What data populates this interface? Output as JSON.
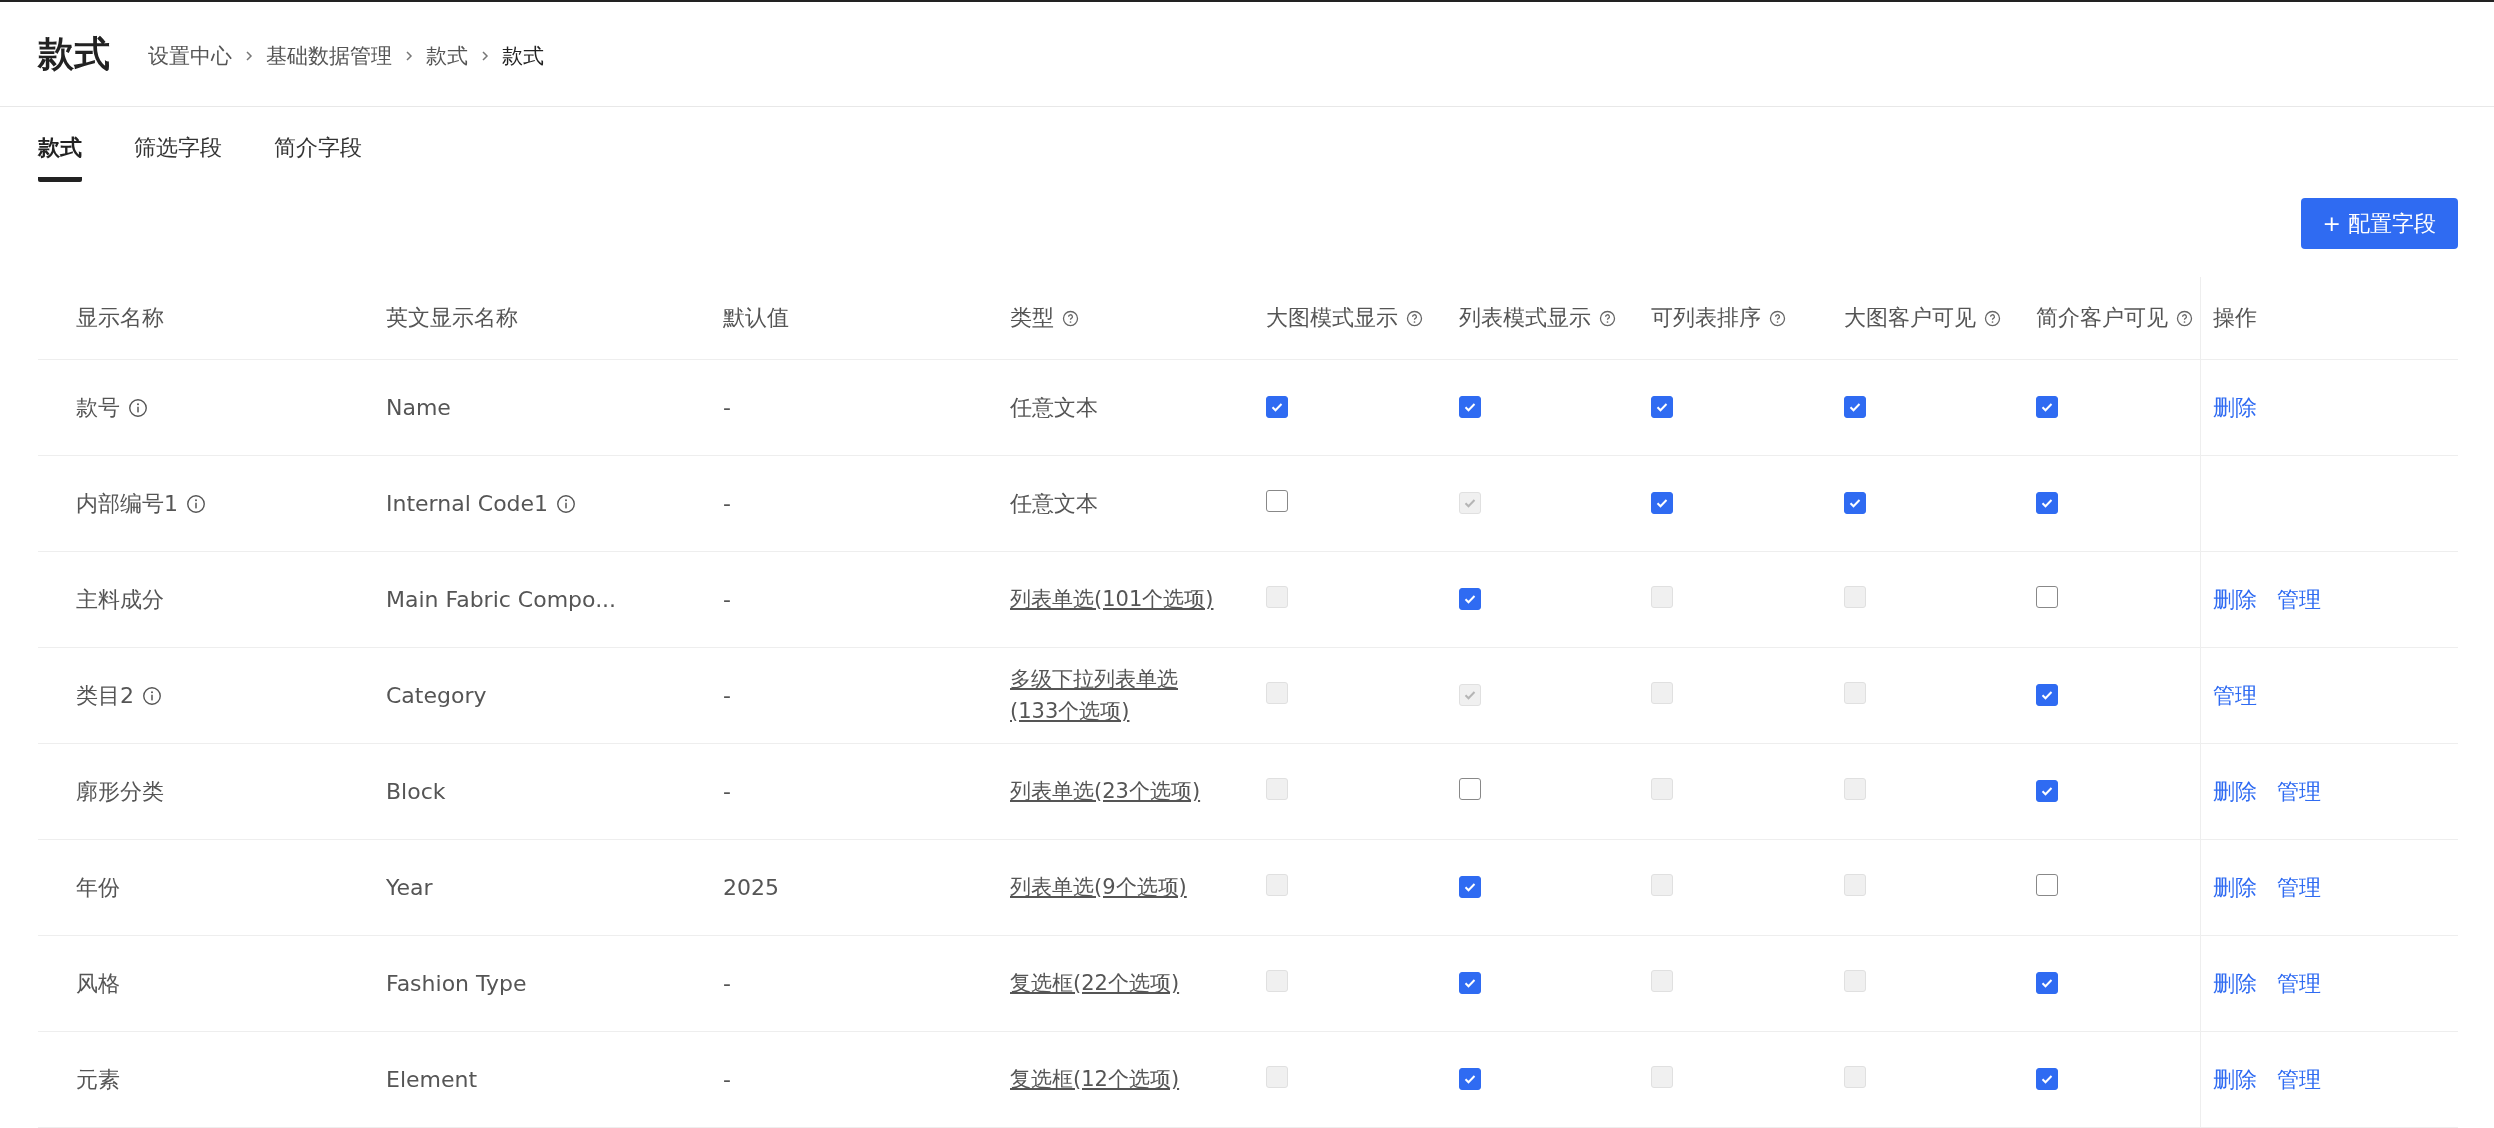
{
  "page": {
    "title": "款式",
    "breadcrumb": [
      "设置中心",
      "基础数据管理",
      "款式",
      "款式"
    ]
  },
  "tabs": [
    {
      "label": "款式",
      "selected": true
    },
    {
      "label": "筛选字段",
      "selected": false
    },
    {
      "label": "简介字段",
      "selected": false
    }
  ],
  "add_button": {
    "label": "+ 配置字段"
  },
  "table": {
    "columns": [
      {
        "label": "显示名称",
        "help": false
      },
      {
        "label": "英文显示名称",
        "help": false
      },
      {
        "label": "默认值",
        "help": false
      },
      {
        "label": "类型",
        "help": true
      },
      {
        "label": "大图模式显示",
        "help": true
      },
      {
        "label": "列表模式显示",
        "help": true
      },
      {
        "label": "可列表排序",
        "help": true
      },
      {
        "label": "大图客户可见",
        "help": true
      },
      {
        "label": "简介客户可见",
        "help": true
      },
      {
        "label": "操作",
        "help": false
      }
    ],
    "rows": [
      {
        "name": "款号",
        "name_info": true,
        "english": "Name",
        "english_info": false,
        "default": "-",
        "type": {
          "label": "任意文本",
          "kind": "text"
        },
        "flags": [
          {
            "checked": true,
            "disabled": false
          },
          {
            "checked": true,
            "disabled": false
          },
          {
            "checked": true,
            "disabled": false
          },
          {
            "checked": true,
            "disabled": false
          },
          {
            "checked": true,
            "disabled": false
          }
        ],
        "actions": [
          "删除"
        ]
      },
      {
        "name": "内部编号1",
        "name_info": true,
        "english": "Internal Code1",
        "english_info": true,
        "default": "-",
        "type": {
          "label": "任意文本",
          "kind": "text"
        },
        "flags": [
          {
            "checked": false,
            "disabled": false
          },
          {
            "checked": true,
            "disabled": true
          },
          {
            "checked": true,
            "disabled": false
          },
          {
            "checked": true,
            "disabled": false
          },
          {
            "checked": true,
            "disabled": false
          }
        ],
        "actions": []
      },
      {
        "name": "主料成分",
        "name_info": false,
        "english": "Main Fabric Compo...",
        "english_info": false,
        "default": "-",
        "type": {
          "label": "列表单选(101个选项)",
          "kind": "link"
        },
        "flags": [
          {
            "checked": false,
            "disabled": true
          },
          {
            "checked": true,
            "disabled": false
          },
          {
            "checked": false,
            "disabled": true
          },
          {
            "checked": false,
            "disabled": true
          },
          {
            "checked": false,
            "disabled": false
          }
        ],
        "actions": [
          "删除",
          "管理"
        ]
      },
      {
        "name": "类目2",
        "name_info": true,
        "english": "Category",
        "english_info": false,
        "default": "-",
        "type": {
          "label": "多级下拉列表单选(133个选项)",
          "kind": "link"
        },
        "flags": [
          {
            "checked": false,
            "disabled": true
          },
          {
            "checked": true,
            "disabled": true
          },
          {
            "checked": false,
            "disabled": true
          },
          {
            "checked": false,
            "disabled": true
          },
          {
            "checked": true,
            "disabled": false
          }
        ],
        "actions": [
          "管理"
        ]
      },
      {
        "name": "廓形分类",
        "name_info": false,
        "english": "Block",
        "english_info": false,
        "default": "-",
        "type": {
          "label": "列表单选(23个选项)",
          "kind": "link"
        },
        "flags": [
          {
            "checked": false,
            "disabled": true
          },
          {
            "checked": false,
            "disabled": false
          },
          {
            "checked": false,
            "disabled": true
          },
          {
            "checked": false,
            "disabled": true
          },
          {
            "checked": true,
            "disabled": false
          }
        ],
        "actions": [
          "删除",
          "管理"
        ]
      },
      {
        "name": "年份",
        "name_info": false,
        "english": "Year",
        "english_info": false,
        "default": "2025",
        "type": {
          "label": "列表单选(9个选项)",
          "kind": "link"
        },
        "flags": [
          {
            "checked": false,
            "disabled": true
          },
          {
            "checked": true,
            "disabled": false
          },
          {
            "checked": false,
            "disabled": true
          },
          {
            "checked": false,
            "disabled": true
          },
          {
            "checked": false,
            "disabled": false
          }
        ],
        "actions": [
          "删除",
          "管理"
        ]
      },
      {
        "name": "风格",
        "name_info": false,
        "english": "Fashion Type",
        "english_info": false,
        "default": "-",
        "type": {
          "label": "复选框(22个选项)",
          "kind": "link"
        },
        "flags": [
          {
            "checked": false,
            "disabled": true
          },
          {
            "checked": true,
            "disabled": false
          },
          {
            "checked": false,
            "disabled": true
          },
          {
            "checked": false,
            "disabled": true
          },
          {
            "checked": true,
            "disabled": false
          }
        ],
        "actions": [
          "删除",
          "管理"
        ]
      },
      {
        "name": "元素",
        "name_info": false,
        "english": "Element",
        "english_info": false,
        "default": "-",
        "type": {
          "label": "复选框(12个选项)",
          "kind": "link"
        },
        "flags": [
          {
            "checked": false,
            "disabled": true
          },
          {
            "checked": true,
            "disabled": false
          },
          {
            "checked": false,
            "disabled": true
          },
          {
            "checked": false,
            "disabled": true
          },
          {
            "checked": true,
            "disabled": false
          }
        ],
        "actions": [
          "删除",
          "管理"
        ]
      }
    ]
  }
}
